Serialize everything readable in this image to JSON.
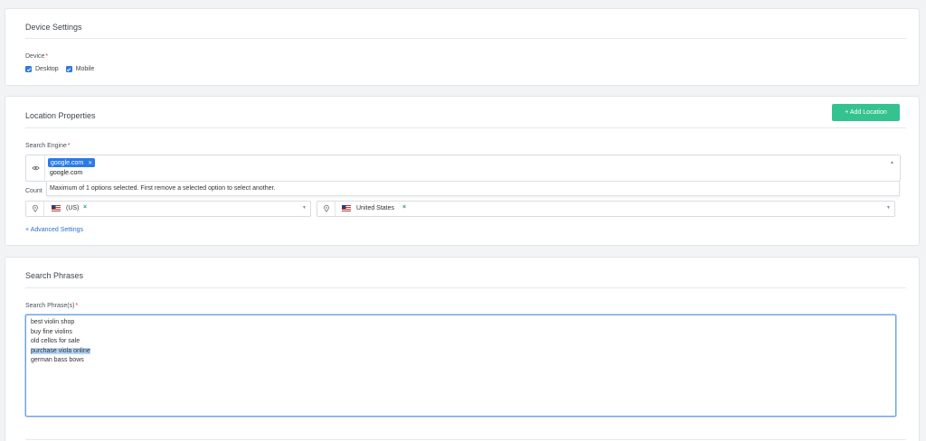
{
  "device": {
    "title": "Device Settings",
    "label": "Device",
    "required_mark": "*",
    "options": [
      {
        "label": "Desktop",
        "checked": true
      },
      {
        "label": "Mobile",
        "checked": true
      }
    ]
  },
  "location": {
    "title": "Location Properties",
    "add_button": "+ Add Location",
    "search_engine_label": "Search Engine",
    "required_mark": "*",
    "selected_tag": "google.com",
    "input_value": "google.com",
    "dropdown_message": "Maximum of 1 options selected. First remove a selected option to select another.",
    "country_label_partial": "Count",
    "language_select": {
      "value": "(US)",
      "remove": "×"
    },
    "country_select": {
      "value": "United States",
      "remove": "×"
    },
    "advanced_link": "+ Advanced Settings"
  },
  "phrases": {
    "title": "Search Phrases",
    "label": "Search Phrase(s)",
    "required_mark": "*",
    "lines": [
      "best violin shop",
      "buy fine violins",
      "old cellos for sale",
      "purchase viola online",
      "german bass bows"
    ],
    "highlighted_line": 3
  },
  "colors": {
    "accent": "#2c7be5",
    "success": "#34c38f",
    "required": "#e3342f"
  },
  "icons": {
    "eye": "eye-icon",
    "pin": "map-pin-icon",
    "check": "check-icon",
    "caret": "caret-icon"
  }
}
